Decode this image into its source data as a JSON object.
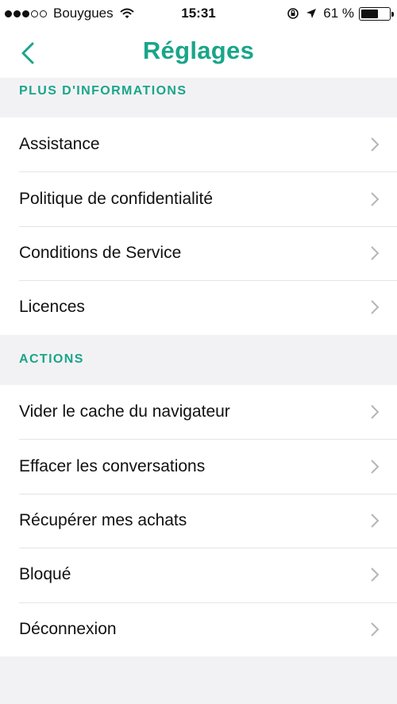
{
  "colors": {
    "accent": "#1aa58a",
    "chevron": "#b5b5b8"
  },
  "status_bar": {
    "signal_dots_filled": 3,
    "signal_dots_total": 5,
    "carrier": "Bouygues",
    "time": "15:31",
    "battery_label": "61 %",
    "battery_level": 0.61
  },
  "nav": {
    "title": "Réglages",
    "back_icon": "chevron-left-icon"
  },
  "sections": [
    {
      "header": "PLUS D'INFORMATIONS",
      "items": [
        "Assistance",
        "Politique de confidentialité",
        "Conditions de Service",
        "Licences"
      ]
    },
    {
      "header": "ACTIONS",
      "items": [
        "Vider le cache du navigateur",
        "Effacer les conversations",
        "Récupérer mes achats",
        "Bloqué",
        "Déconnexion"
      ]
    }
  ]
}
